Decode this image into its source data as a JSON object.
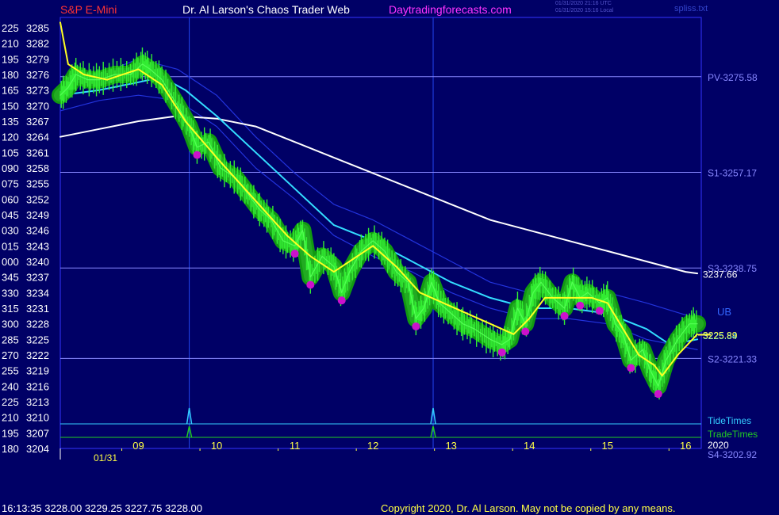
{
  "header": {
    "symbol": "S&P E-Mini",
    "title": "Dr. Al Larson's Chaos Trader Web",
    "site": "Daytradingforecasts.com",
    "timestamp_utc": "01/31/2020 21:16 UTC",
    "timestamp_local": "01/31/2020 15:16 Local",
    "file": "spliss.txt"
  },
  "footer": {
    "quote": "16:13:35  3228.00  3229.25  3227.75  3228.00",
    "copyright": "Copyright 2020, Dr. Al Larson. May not be copied by any means."
  },
  "colors": {
    "background": "#000066",
    "price_bar": "#33ee33",
    "price_halo": "#119911",
    "magenta_marks": "#cc11cc",
    "yellow_line": "#ffff22",
    "cyan_line": "#33ddff",
    "white_line": "#ffffff",
    "channel_line": "#2233dd",
    "level_line": "#8888ff",
    "tide_times": "#33ccff",
    "trade_times": "#22cc22"
  },
  "chart_data": {
    "type": "line",
    "ylim": [
      3204,
      3288
    ],
    "xlim": [
      8.0,
      16.2
    ],
    "y_ticks": [
      {
        "angle": "225",
        "price": 3285
      },
      {
        "angle": "210",
        "price": 3282
      },
      {
        "angle": "195",
        "price": 3279
      },
      {
        "angle": "180",
        "price": 3276
      },
      {
        "angle": "165",
        "price": 3273
      },
      {
        "angle": "150",
        "price": 3270
      },
      {
        "angle": "135",
        "price": 3267
      },
      {
        "angle": "120",
        "price": 3264
      },
      {
        "angle": "105",
        "price": 3261
      },
      {
        "angle": "090",
        "price": 3258
      },
      {
        "angle": "075",
        "price": 3255
      },
      {
        "angle": "060",
        "price": 3252
      },
      {
        "angle": "045",
        "price": 3249
      },
      {
        "angle": "030",
        "price": 3246
      },
      {
        "angle": "015",
        "price": 3243
      },
      {
        "angle": "000",
        "price": 3240
      },
      {
        "angle": "345",
        "price": 3237
      },
      {
        "angle": "330",
        "price": 3234
      },
      {
        "angle": "315",
        "price": 3231
      },
      {
        "angle": "300",
        "price": 3228
      },
      {
        "angle": "285",
        "price": 3225
      },
      {
        "angle": "270",
        "price": 3222
      },
      {
        "angle": "255",
        "price": 3219
      },
      {
        "angle": "240",
        "price": 3216
      },
      {
        "angle": "225",
        "price": 3213
      },
      {
        "angle": "210",
        "price": 3210
      },
      {
        "angle": "195",
        "price": 3207
      },
      {
        "angle": "180",
        "price": 3204
      }
    ],
    "x_ticks": [
      "09",
      "10",
      "11",
      "12",
      "13",
      "14",
      "15",
      "16"
    ],
    "x_tick_hours": [
      9,
      10,
      11,
      12,
      13,
      14,
      15,
      16
    ],
    "date_label": "01/31",
    "levels": [
      {
        "label": "PV-3275.58",
        "value": 3275.58
      },
      {
        "label": "S1-3257.17",
        "value": 3257.17
      },
      {
        "label": "S3-3238.75",
        "value": 3238.75
      },
      {
        "label": "S2-3221.33",
        "value": 3221.33
      }
    ],
    "bottom_level_label": "S4-3202.92",
    "value_labels": [
      {
        "text": "3237.66",
        "value": 3237.66,
        "color": "white"
      },
      {
        "text": "3225.84",
        "value": 3225.84,
        "color": "cyan"
      },
      {
        "text": "3225.89",
        "value": 3225.89,
        "color": "yellow"
      }
    ],
    "channel_label": "UB",
    "tide_times_label": "TideTimes",
    "trade_times_label": "TradeTimes",
    "year_label": "2020",
    "event_times": [
      9.65,
      12.77
    ],
    "price_series": {
      "x": [
        8.0,
        8.1,
        8.2,
        8.35,
        8.5,
        8.7,
        8.9,
        9.05,
        9.15,
        9.3,
        9.5,
        9.65,
        9.75,
        9.9,
        10.05,
        10.25,
        10.4,
        10.55,
        10.7,
        10.85,
        11.0,
        11.1,
        11.2,
        11.35,
        11.5,
        11.6,
        11.7,
        11.85,
        12.0,
        12.15,
        12.3,
        12.45,
        12.55,
        12.65,
        12.75,
        12.85,
        13.0,
        13.15,
        13.3,
        13.5,
        13.65,
        13.75,
        13.85,
        13.95,
        14.05,
        14.15,
        14.3,
        14.45,
        14.55,
        14.65,
        14.75,
        14.9,
        15.0,
        15.1,
        15.2,
        15.3,
        15.45,
        15.55,
        15.65,
        15.75,
        15.9,
        16.05,
        16.15
      ],
      "values": [
        3272,
        3273.5,
        3276,
        3275,
        3275,
        3276,
        3276,
        3278,
        3277,
        3275,
        3270,
        3266,
        3262,
        3263,
        3258,
        3256,
        3253,
        3250,
        3248,
        3244,
        3243,
        3246,
        3237,
        3241,
        3239,
        3234,
        3238,
        3242,
        3244,
        3242,
        3238,
        3236,
        3229,
        3231,
        3236,
        3232,
        3230,
        3228,
        3227,
        3225,
        3224,
        3225,
        3231,
        3228,
        3234,
        3236,
        3233,
        3231,
        3236,
        3233,
        3234,
        3232,
        3233,
        3228,
        3226,
        3221,
        3223,
        3219,
        3216,
        3221,
        3225,
        3228,
        3228
      ]
    },
    "yellow_series": {
      "x": [
        8.0,
        8.1,
        8.3,
        8.6,
        9.0,
        9.3,
        9.6,
        10.0,
        10.3,
        10.6,
        10.9,
        11.2,
        11.5,
        11.8,
        12.0,
        12.3,
        12.6,
        12.9,
        13.2,
        13.5,
        13.8,
        14.0,
        14.2,
        14.5,
        14.8,
        15.0,
        15.2,
        15.4,
        15.6,
        15.7,
        15.9,
        16.15
      ],
      "values": [
        3286,
        3278,
        3276,
        3275,
        3277,
        3274,
        3267,
        3260,
        3255,
        3250,
        3245,
        3241,
        3238,
        3241,
        3243,
        3239,
        3234,
        3232,
        3230,
        3228,
        3226,
        3229,
        3233,
        3233,
        3233,
        3232,
        3227,
        3222,
        3220,
        3218,
        3222,
        3226
      ]
    },
    "cyan_series": {
      "x": [
        8.0,
        8.5,
        9.0,
        9.3,
        9.6,
        10.0,
        10.5,
        11.0,
        11.5,
        12.0,
        12.5,
        13.0,
        13.5,
        14.0,
        14.5,
        15.0,
        15.5,
        15.8,
        16.15
      ],
      "values": [
        3272,
        3273,
        3274.5,
        3275.5,
        3273,
        3268,
        3261,
        3254,
        3247,
        3244,
        3240,
        3236,
        3233,
        3231,
        3231,
        3230,
        3227,
        3224,
        3225
      ]
    },
    "white_series": {
      "x": [
        8.0,
        8.5,
        9.0,
        9.5,
        10.0,
        10.5,
        11.0,
        11.5,
        12.0,
        12.5,
        13.0,
        13.5,
        14.0,
        14.5,
        15.0,
        15.5,
        16.0,
        16.15
      ],
      "values": [
        3264,
        3265.5,
        3267,
        3268,
        3267.5,
        3266,
        3263,
        3260,
        3257,
        3254,
        3251,
        3248,
        3246,
        3244,
        3242,
        3240,
        3238,
        3237.7
      ]
    },
    "channel_upper": {
      "x": [
        8.0,
        8.5,
        9.0,
        9.5,
        10.0,
        10.5,
        11.0,
        11.5,
        12.0,
        12.5,
        13.0,
        13.5,
        14.0,
        14.5,
        15.0,
        15.5,
        16.15
      ],
      "values": [
        3273,
        3276,
        3279,
        3277,
        3272,
        3264,
        3257,
        3251,
        3248,
        3244,
        3240,
        3236,
        3234,
        3234,
        3234,
        3232,
        3229
      ]
    },
    "channel_lower": {
      "x": [
        8.0,
        8.5,
        9.0,
        9.5,
        10.0,
        10.5,
        11.0,
        11.5,
        12.0,
        12.5,
        13.0,
        13.5,
        14.0,
        14.5,
        15.0,
        15.5,
        16.15
      ],
      "values": [
        3269,
        3271,
        3272,
        3271,
        3266,
        3258,
        3252,
        3245,
        3241,
        3238,
        3234,
        3231,
        3229,
        3229,
        3228,
        3225,
        3223
      ]
    }
  }
}
